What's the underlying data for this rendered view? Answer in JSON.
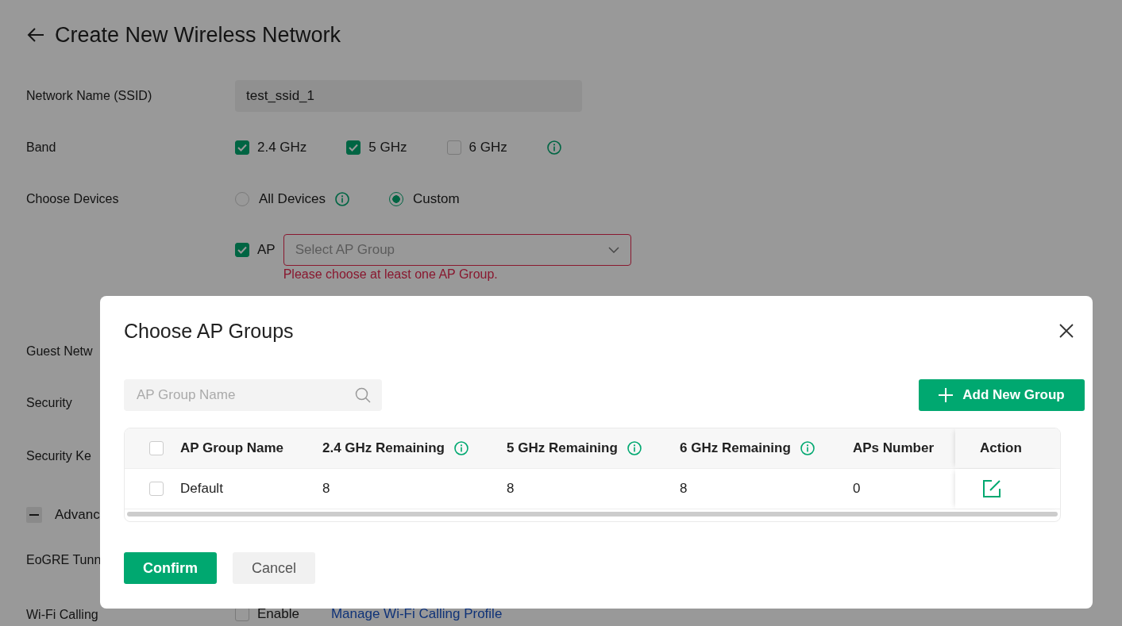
{
  "page": {
    "title": "Create New Wireless Network",
    "network_name": {
      "label": "Network Name (SSID)",
      "value": "test_ssid_1"
    },
    "band": {
      "label": "Band",
      "info": true,
      "options": [
        {
          "label": "2.4 GHz",
          "checked": true
        },
        {
          "label": "5 GHz",
          "checked": true
        },
        {
          "label": "6 GHz",
          "checked": false
        }
      ]
    },
    "choose_devices": {
      "label": "Choose Devices",
      "options": [
        {
          "label": "All Devices",
          "selected": false,
          "info": true
        },
        {
          "label": "Custom",
          "selected": true,
          "info": false
        }
      ],
      "ap": {
        "label": "AP",
        "checked": true,
        "placeholder": "Select AP Group",
        "error": "Please choose at least one AP Group."
      }
    },
    "rows_behind": [
      {
        "kind": "label",
        "label": "Guest Netw"
      },
      {
        "kind": "label",
        "label": "Security"
      },
      {
        "kind": "label",
        "label": "Security Ke"
      },
      {
        "kind": "section",
        "label": "Advanc",
        "expanded": true
      },
      {
        "kind": "label",
        "label": "EoGRE Tunn"
      },
      {
        "kind": "option",
        "label": "Wi-Fi Calling",
        "checkbox": {
          "label": "Enable",
          "checked": false
        },
        "link": "Manage Wi-Fi Calling Profile"
      }
    ]
  },
  "modal": {
    "title": "Choose AP Groups",
    "search": {
      "placeholder": "AP Group Name"
    },
    "add_button": "Add New Group",
    "table": {
      "select_all_checked": false,
      "columns": [
        {
          "label": "AP Group Name",
          "info": false
        },
        {
          "label": "2.4 GHz Remaining",
          "info": true
        },
        {
          "label": "5 GHz Remaining",
          "info": true
        },
        {
          "label": "6 GHz Remaining",
          "info": true
        },
        {
          "label": "APs Number",
          "info": false
        },
        {
          "label": "Action",
          "info": false
        }
      ],
      "rows": [
        {
          "checked": false,
          "cells": [
            "Default",
            "8",
            "8",
            "8",
            "0"
          ]
        }
      ]
    },
    "buttons": [
      {
        "label": "Confirm",
        "kind": "primary"
      },
      {
        "label": "Cancel",
        "kind": "secondary"
      }
    ]
  }
}
